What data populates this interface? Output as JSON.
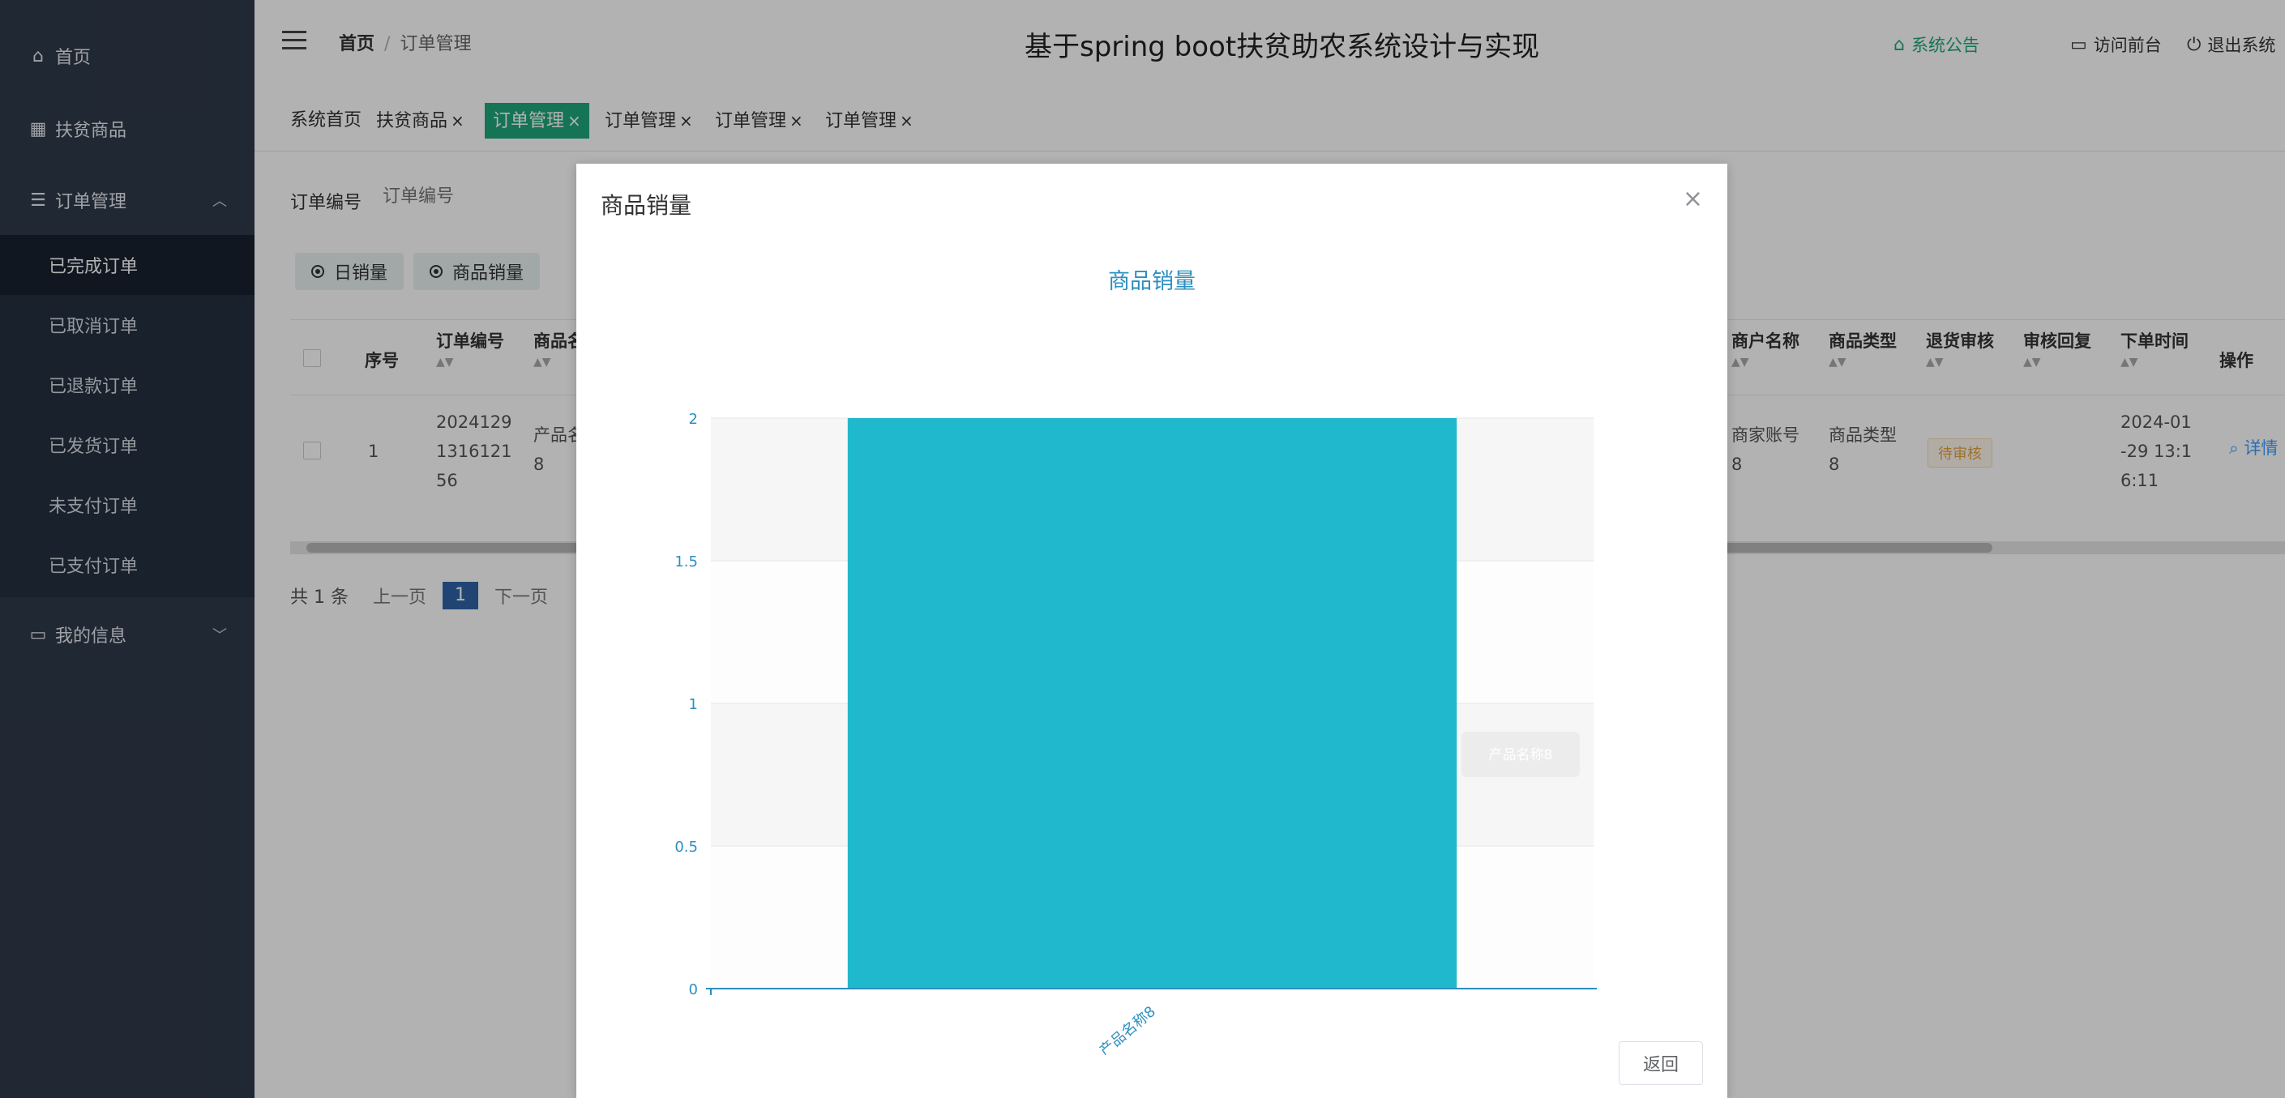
{
  "sidebar": {
    "items": [
      {
        "label": "首页",
        "icon": "home-icon"
      },
      {
        "label": "扶贫商品",
        "icon": "grid-icon"
      },
      {
        "label": "订单管理",
        "icon": "list-icon"
      },
      {
        "label": "我的信息",
        "icon": "card-icon"
      }
    ],
    "order_sub": [
      "已完成订单",
      "已取消订单",
      "已退款订单",
      "已发货订单",
      "未支付订单",
      "已支付订单"
    ]
  },
  "header": {
    "crumb_home": "首页",
    "crumb_current": "订单管理",
    "title": "基于spring boot扶贫助农系统设计与实现",
    "notice": "系统公告",
    "visit_front": "访问前台",
    "logout": "退出系统"
  },
  "tabs": [
    {
      "label": "系统首页",
      "closable": false
    },
    {
      "label": "扶贫商品",
      "closable": true
    },
    {
      "label": "订单管理",
      "closable": true,
      "active": true
    },
    {
      "label": "订单管理",
      "closable": true
    },
    {
      "label": "订单管理",
      "closable": true
    },
    {
      "label": "订单管理",
      "closable": true
    }
  ],
  "search": {
    "label": "订单编号",
    "placeholder": "订单编号"
  },
  "buttons": {
    "daily_sales": "日销量",
    "product_sales": "商品销量"
  },
  "table": {
    "headers": {
      "index": "序号",
      "order_no": "订单编号",
      "product_name": "商品名称",
      "merchant_name": "商户名称",
      "product_type": "商品类型",
      "return_review": "退货审核",
      "review_reply": "审核回复",
      "order_time": "下单时间",
      "actions": "操作"
    },
    "row": {
      "index": "1",
      "order_no": [
        "2024129",
        "1316121",
        "56"
      ],
      "product_name": [
        "产品名称",
        "8"
      ],
      "merchant_name": [
        "商家账号",
        "8"
      ],
      "product_type": [
        "商品类型",
        "8"
      ],
      "return_review": "待审核",
      "order_time": [
        "2024-01",
        "-29 13:1",
        "6:11"
      ],
      "action_detail": "详情"
    }
  },
  "pager": {
    "total": "共 1 条",
    "prev": "上一页",
    "page": "1",
    "next": "下一页"
  },
  "modal": {
    "title": "商品销量",
    "close": "×",
    "back": "返回",
    "tooltip": "产品名称8"
  },
  "chart_data": {
    "type": "bar",
    "title": "商品销量",
    "categories": [
      "产品名称8"
    ],
    "values": [
      2
    ],
    "ylim": [
      0,
      2
    ],
    "yticks": [
      "0",
      "0.5",
      "1",
      "1.5",
      "2"
    ],
    "grid": true,
    "bar_color": "#20b8cc",
    "axis_color": "#2c8fbf"
  },
  "colors": {
    "accent": "#1fa67a",
    "sidebar_bg": "#2f3a4a"
  }
}
